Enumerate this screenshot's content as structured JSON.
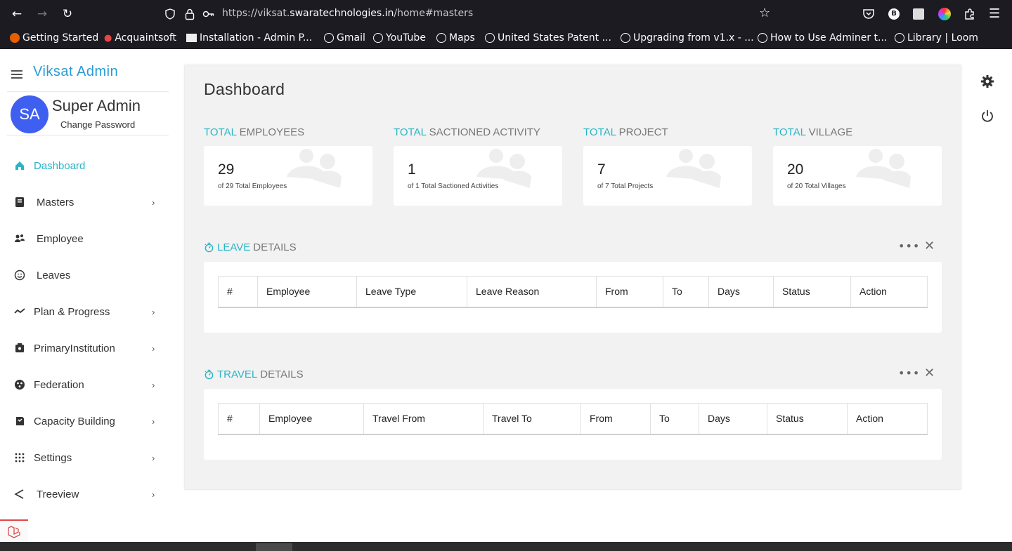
{
  "browser": {
    "url_prefix": "https://viksat.",
    "url_host": "swaratechnologies.in",
    "url_suffix": "/home#masters",
    "bookmarks": [
      "Getting Started",
      "Acquaintsoft",
      "Installation - Admin P...",
      "Gmail",
      "YouTube",
      "Maps",
      "United States Patent ...",
      "Upgrading from v1.x - ...",
      "How to Use Adminer t...",
      "Library | Loom"
    ]
  },
  "sidebar": {
    "brand": "Viksat Admin",
    "avatar_initials": "SA",
    "user_name": "Super Admin",
    "change_password": "Change Password",
    "items": [
      {
        "label": "Dashboard",
        "icon": "home-icon",
        "chevron": false,
        "active": true
      },
      {
        "label": "Masters",
        "icon": "book-icon",
        "chevron": true
      },
      {
        "label": "Employee",
        "icon": "users-icon",
        "chevron": false
      },
      {
        "label": "Leaves",
        "icon": "smile-icon",
        "chevron": false
      },
      {
        "label": "Plan & Progress",
        "icon": "trend-icon",
        "chevron": true
      },
      {
        "label": "PrimaryInstitution",
        "icon": "institution-icon",
        "chevron": true
      },
      {
        "label": "Federation",
        "icon": "federation-icon",
        "chevron": true
      },
      {
        "label": "Capacity Building",
        "icon": "building-icon",
        "chevron": true
      },
      {
        "label": "Settings",
        "icon": "grid-icon",
        "chevron": true
      },
      {
        "label": "Treeview",
        "icon": "triangle-icon",
        "chevron": true
      }
    ]
  },
  "main": {
    "title": "Dashboard",
    "stats": [
      {
        "prefix": "TOTAL",
        "label": "EMPLOYEES",
        "value": "29",
        "sub": "of 29 Total Employees"
      },
      {
        "prefix": "TOTAL",
        "label": "SACTIONED ACTIVITY",
        "value": "1",
        "sub": "of 1 Total Sactioned Activities"
      },
      {
        "prefix": "TOTAL",
        "label": "PROJECT",
        "value": "7",
        "sub": "of 7 Total Projects"
      },
      {
        "prefix": "TOTAL",
        "label": "VILLAGE",
        "value": "20",
        "sub": "of 20 Total Villages"
      }
    ],
    "leave": {
      "accent": "LEAVE",
      "title": "DETAILS",
      "columns": [
        "#",
        "Employee",
        "Leave Type",
        "Leave Reason",
        "From",
        "To",
        "Days",
        "Status",
        "Action"
      ]
    },
    "travel": {
      "accent": "TRAVEL",
      "title": "DETAILS",
      "columns": [
        "#",
        "Employee",
        "Travel From",
        "Travel To",
        "From",
        "To",
        "Days",
        "Status",
        "Action"
      ]
    }
  },
  "colors": {
    "accent": "#2ab5c6",
    "brand": "#2a9bd6",
    "avatar": "#3f5ff0"
  }
}
